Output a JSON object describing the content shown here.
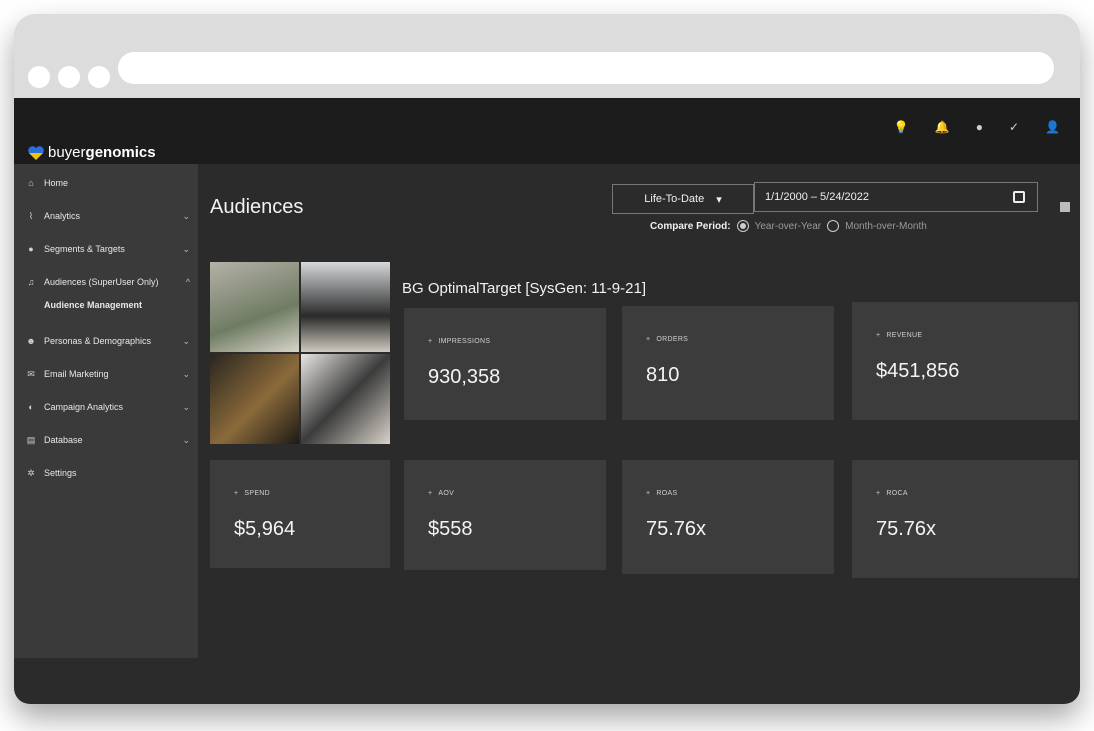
{
  "brand": {
    "prefix": "buyer",
    "name": "genomics"
  },
  "sidebar": {
    "items": [
      {
        "label": "Home",
        "icon": "home-icon",
        "chevron": ""
      },
      {
        "label": "Analytics",
        "icon": "pulse-icon",
        "chevron": "⌄"
      },
      {
        "label": "Segments & Targets",
        "icon": "pie-icon",
        "chevron": "⌄"
      },
      {
        "label": "Audiences (SuperUser Only)",
        "icon": "music-icon",
        "chevron": "^"
      },
      {
        "label": "Personas & Demographics",
        "icon": "people-icon",
        "chevron": "⌄"
      },
      {
        "label": "Email Marketing",
        "icon": "mail-icon",
        "chevron": "⌄"
      },
      {
        "label": "Campaign Analytics",
        "icon": "megaphone-icon",
        "chevron": "⌄"
      },
      {
        "label": "Database",
        "icon": "database-icon",
        "chevron": "⌄"
      },
      {
        "label": "Settings",
        "icon": "gear-icon",
        "chevron": ""
      }
    ],
    "subitem": "Audience Management"
  },
  "page": {
    "title": "Audiences"
  },
  "filters": {
    "period": "Life-To-Date",
    "period_caret": "▾",
    "range": "1/1/2000 – 5/24/2022",
    "compare_label": "Compare Period:",
    "compare_yoy": "Year-over-Year",
    "compare_mom": "Month-over-Month"
  },
  "segment": {
    "title": "BG OptimalTarget [SysGen: 11-9-21]"
  },
  "metrics": [
    {
      "label": "IMPRESSIONS",
      "value": "930,358"
    },
    {
      "label": "ORDERS",
      "value": "810"
    },
    {
      "label": "REVENUE",
      "value": "$451,856"
    },
    {
      "label": "SPEND",
      "value": "$5,964"
    },
    {
      "label": "AOV",
      "value": "$558"
    },
    {
      "label": "ROAS",
      "value": "75.76x"
    },
    {
      "label": "ROCA",
      "value": "75.76x"
    }
  ],
  "colors": {
    "accent_blue": "#2a6fdb",
    "accent_yellow": "#f2c200",
    "background": "#2b2b2b",
    "card": "#3c3c3c"
  }
}
